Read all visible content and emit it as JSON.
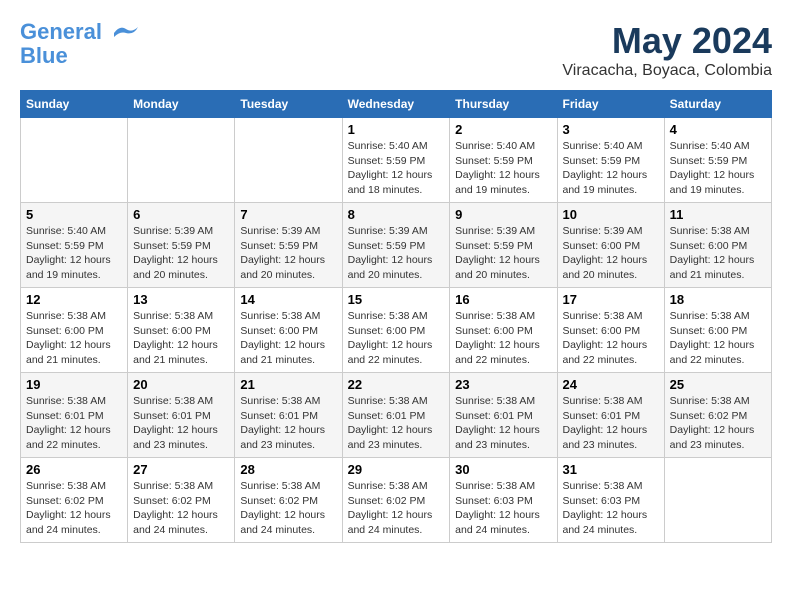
{
  "header": {
    "logo_line1": "General",
    "logo_line2": "Blue",
    "month_year": "May 2024",
    "location": "Viracacha, Boyaca, Colombia"
  },
  "weekdays": [
    "Sunday",
    "Monday",
    "Tuesday",
    "Wednesday",
    "Thursday",
    "Friday",
    "Saturday"
  ],
  "weeks": [
    [
      {
        "day": "",
        "info": ""
      },
      {
        "day": "",
        "info": ""
      },
      {
        "day": "",
        "info": ""
      },
      {
        "day": "1",
        "info": "Sunrise: 5:40 AM\nSunset: 5:59 PM\nDaylight: 12 hours\nand 18 minutes."
      },
      {
        "day": "2",
        "info": "Sunrise: 5:40 AM\nSunset: 5:59 PM\nDaylight: 12 hours\nand 19 minutes."
      },
      {
        "day": "3",
        "info": "Sunrise: 5:40 AM\nSunset: 5:59 PM\nDaylight: 12 hours\nand 19 minutes."
      },
      {
        "day": "4",
        "info": "Sunrise: 5:40 AM\nSunset: 5:59 PM\nDaylight: 12 hours\nand 19 minutes."
      }
    ],
    [
      {
        "day": "5",
        "info": "Sunrise: 5:40 AM\nSunset: 5:59 PM\nDaylight: 12 hours\nand 19 minutes."
      },
      {
        "day": "6",
        "info": "Sunrise: 5:39 AM\nSunset: 5:59 PM\nDaylight: 12 hours\nand 20 minutes."
      },
      {
        "day": "7",
        "info": "Sunrise: 5:39 AM\nSunset: 5:59 PM\nDaylight: 12 hours\nand 20 minutes."
      },
      {
        "day": "8",
        "info": "Sunrise: 5:39 AM\nSunset: 5:59 PM\nDaylight: 12 hours\nand 20 minutes."
      },
      {
        "day": "9",
        "info": "Sunrise: 5:39 AM\nSunset: 5:59 PM\nDaylight: 12 hours\nand 20 minutes."
      },
      {
        "day": "10",
        "info": "Sunrise: 5:39 AM\nSunset: 6:00 PM\nDaylight: 12 hours\nand 20 minutes."
      },
      {
        "day": "11",
        "info": "Sunrise: 5:38 AM\nSunset: 6:00 PM\nDaylight: 12 hours\nand 21 minutes."
      }
    ],
    [
      {
        "day": "12",
        "info": "Sunrise: 5:38 AM\nSunset: 6:00 PM\nDaylight: 12 hours\nand 21 minutes."
      },
      {
        "day": "13",
        "info": "Sunrise: 5:38 AM\nSunset: 6:00 PM\nDaylight: 12 hours\nand 21 minutes."
      },
      {
        "day": "14",
        "info": "Sunrise: 5:38 AM\nSunset: 6:00 PM\nDaylight: 12 hours\nand 21 minutes."
      },
      {
        "day": "15",
        "info": "Sunrise: 5:38 AM\nSunset: 6:00 PM\nDaylight: 12 hours\nand 22 minutes."
      },
      {
        "day": "16",
        "info": "Sunrise: 5:38 AM\nSunset: 6:00 PM\nDaylight: 12 hours\nand 22 minutes."
      },
      {
        "day": "17",
        "info": "Sunrise: 5:38 AM\nSunset: 6:00 PM\nDaylight: 12 hours\nand 22 minutes."
      },
      {
        "day": "18",
        "info": "Sunrise: 5:38 AM\nSunset: 6:00 PM\nDaylight: 12 hours\nand 22 minutes."
      }
    ],
    [
      {
        "day": "19",
        "info": "Sunrise: 5:38 AM\nSunset: 6:01 PM\nDaylight: 12 hours\nand 22 minutes."
      },
      {
        "day": "20",
        "info": "Sunrise: 5:38 AM\nSunset: 6:01 PM\nDaylight: 12 hours\nand 23 minutes."
      },
      {
        "day": "21",
        "info": "Sunrise: 5:38 AM\nSunset: 6:01 PM\nDaylight: 12 hours\nand 23 minutes."
      },
      {
        "day": "22",
        "info": "Sunrise: 5:38 AM\nSunset: 6:01 PM\nDaylight: 12 hours\nand 23 minutes."
      },
      {
        "day": "23",
        "info": "Sunrise: 5:38 AM\nSunset: 6:01 PM\nDaylight: 12 hours\nand 23 minutes."
      },
      {
        "day": "24",
        "info": "Sunrise: 5:38 AM\nSunset: 6:01 PM\nDaylight: 12 hours\nand 23 minutes."
      },
      {
        "day": "25",
        "info": "Sunrise: 5:38 AM\nSunset: 6:02 PM\nDaylight: 12 hours\nand 23 minutes."
      }
    ],
    [
      {
        "day": "26",
        "info": "Sunrise: 5:38 AM\nSunset: 6:02 PM\nDaylight: 12 hours\nand 24 minutes."
      },
      {
        "day": "27",
        "info": "Sunrise: 5:38 AM\nSunset: 6:02 PM\nDaylight: 12 hours\nand 24 minutes."
      },
      {
        "day": "28",
        "info": "Sunrise: 5:38 AM\nSunset: 6:02 PM\nDaylight: 12 hours\nand 24 minutes."
      },
      {
        "day": "29",
        "info": "Sunrise: 5:38 AM\nSunset: 6:02 PM\nDaylight: 12 hours\nand 24 minutes."
      },
      {
        "day": "30",
        "info": "Sunrise: 5:38 AM\nSunset: 6:03 PM\nDaylight: 12 hours\nand 24 minutes."
      },
      {
        "day": "31",
        "info": "Sunrise: 5:38 AM\nSunset: 6:03 PM\nDaylight: 12 hours\nand 24 minutes."
      },
      {
        "day": "",
        "info": ""
      }
    ]
  ]
}
